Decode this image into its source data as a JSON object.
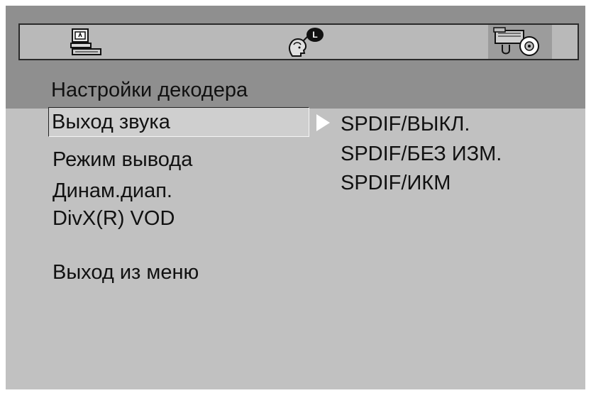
{
  "tabs": [
    {
      "name": "pc-setup",
      "icon": "computer-icon",
      "selected": false
    },
    {
      "name": "language",
      "icon": "speaking-head-icon",
      "selected": false
    },
    {
      "name": "decoder",
      "icon": "camera-disc-icon",
      "selected": true
    }
  ],
  "page_title": "Настройки декодера",
  "menu": {
    "items": [
      {
        "label": "Выход звука",
        "selected": true
      },
      {
        "label": "Режим вывода"
      },
      {
        "label": "Динам.диап."
      },
      {
        "label": "DivX(R)  VOD"
      },
      {
        "label": "Выход из меню"
      }
    ]
  },
  "options": {
    "items": [
      {
        "label": "SPDIF/ВЫКЛ."
      },
      {
        "label": "SPDIF/БЕЗ ИЗМ."
      },
      {
        "label": "SPDIF/ИКМ"
      }
    ]
  },
  "colors": {
    "panel": "#c1c1c1",
    "header_band": "#8f8f8f",
    "icon_bar": "#b9b9b9",
    "text": "#111111"
  }
}
